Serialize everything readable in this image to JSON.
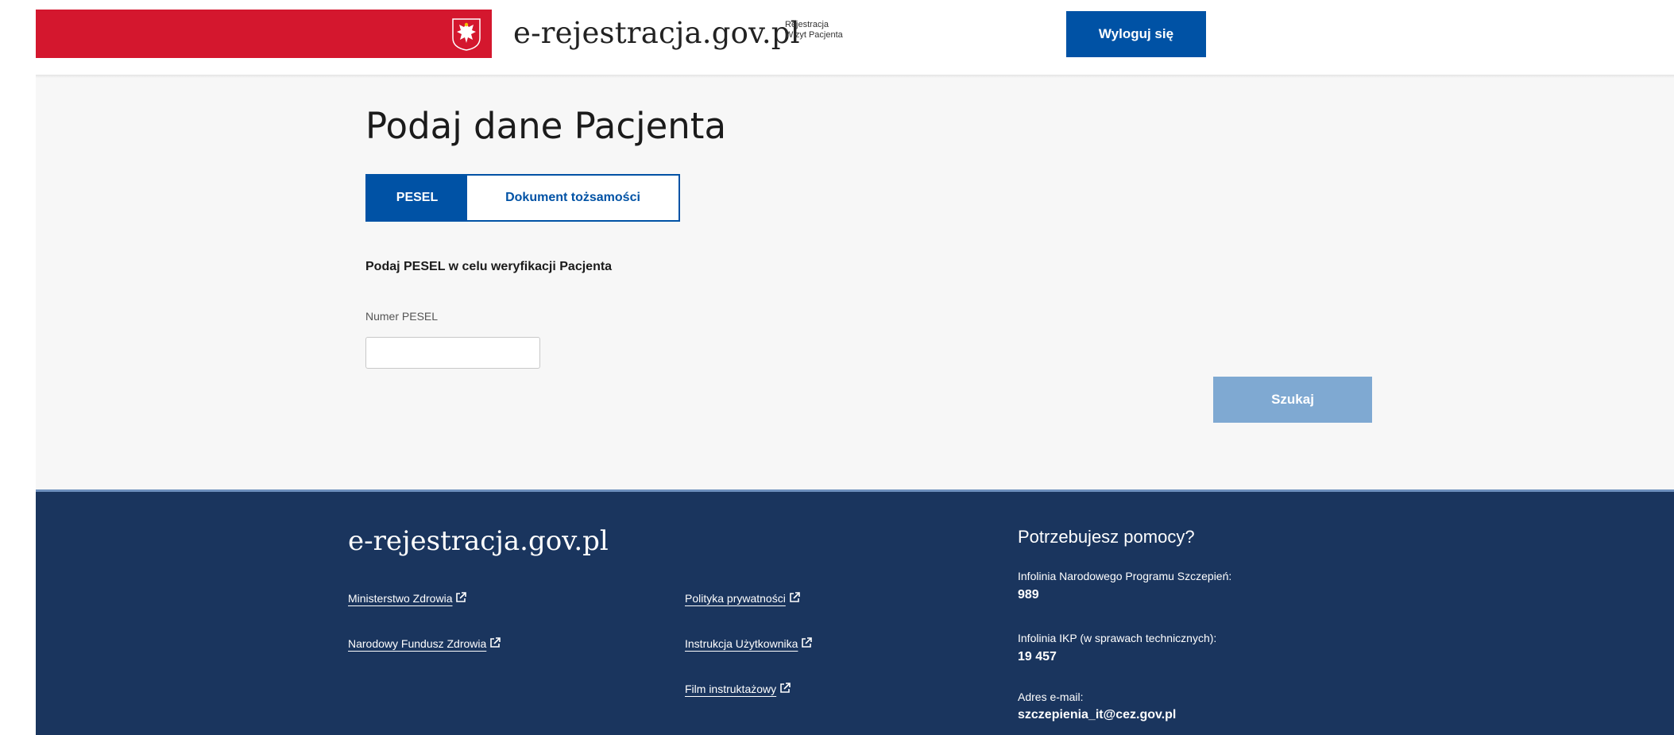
{
  "header": {
    "brand": "e-rejestracja.gov.pl",
    "subtitle_line1": "Rejestracja",
    "subtitle_line2": "Wizyt Pacjenta",
    "logout_label": "Wyloguj się"
  },
  "main": {
    "title": "Podaj dane Pacjenta",
    "tabs": [
      {
        "label": "PESEL",
        "active": true
      },
      {
        "label": "Dokument tożsamości",
        "active": false
      }
    ],
    "instruction": "Podaj PESEL w celu weryfikacji Pacjenta",
    "pesel_label": "Numer PESEL",
    "pesel_value": "",
    "search_label": "Szukaj"
  },
  "footer": {
    "brand": "e-rejestracja.gov.pl",
    "links_col1": [
      "Ministerstwo Zdrowia",
      "Narodowy Fundusz Zdrowia"
    ],
    "links_col2": [
      "Polityka prywatności",
      "Instrukcja Użytkownika",
      "Film instruktażowy"
    ],
    "help": {
      "title": "Potrzebujesz pomocy?",
      "items": [
        {
          "label": "Infolinia Narodowego Programu Szczepień:",
          "value": "989"
        },
        {
          "label": "Infolinia IKP (w sprawach technicznych):",
          "value": "19 457"
        },
        {
          "label": "Adres e-mail:",
          "value": "szczepienia_it@cez.gov.pl"
        }
      ]
    }
  },
  "colors": {
    "brand_red": "#d4172e",
    "primary_blue": "#0052a5",
    "disabled_blue": "#7fa9d2",
    "footer_navy": "#1a355e"
  },
  "icons": [
    "polish-eagle-icon",
    "external-link-icon"
  ]
}
